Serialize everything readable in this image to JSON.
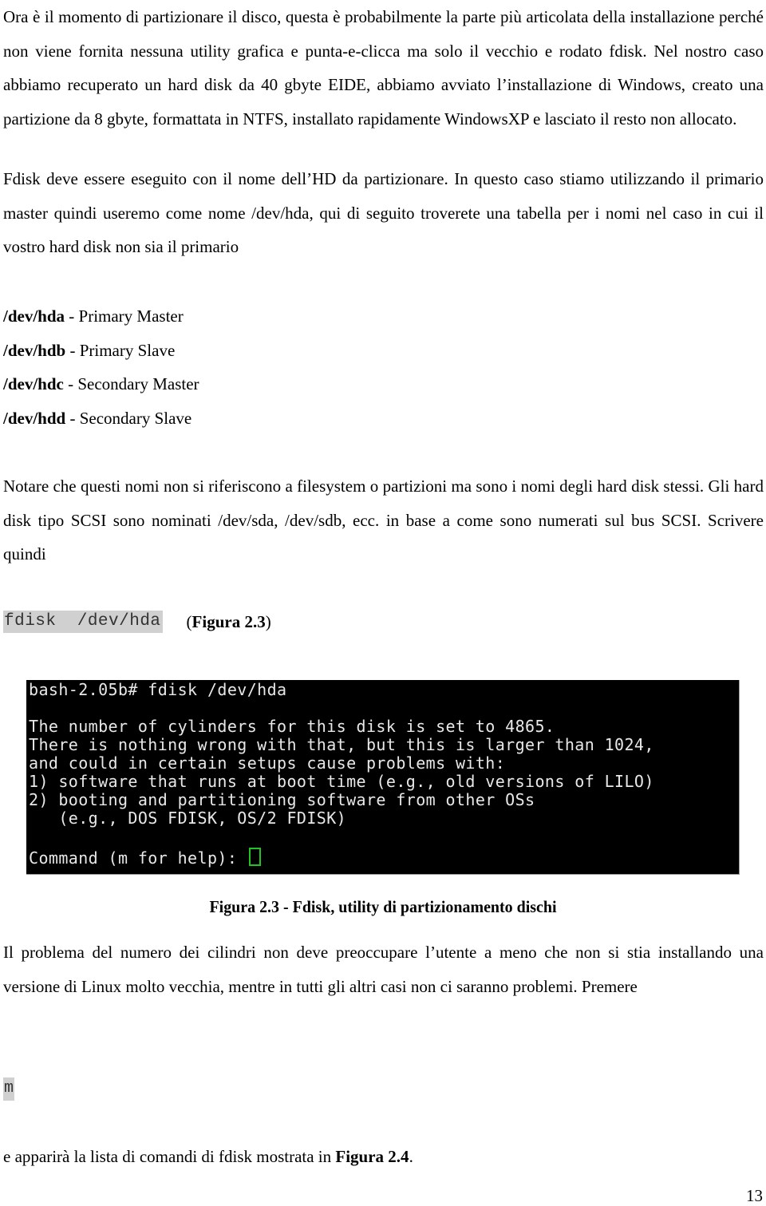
{
  "intro_paragraph": "Ora è il momento di partizionare il disco, questa è probabilmente la parte più articolata della installazione perché non viene fornita nessuna utility grafica e punta-e-clicca ma solo il vecchio e rodato fdisk. Nel nostro caso abbiamo recuperato un hard disk da 40 gbyte EIDE, abbiamo avviato l’installazione di Windows, creato una partizione da 8 gbyte, formattata in NTFS, installato rapidamente WindowsXP e lasciato il resto non allocato.",
  "fdisk_paragraph": "Fdisk deve essere eseguito con il nome dell’HD da partizionare. In questo caso stiamo utilizzando il primario master quindi useremo come nome /dev/hda, qui di seguito troverete una tabella per i nomi nel caso in cui il vostro hard disk non sia il primario",
  "device_list": [
    {
      "device": "/dev/hda",
      "desc": " - Primary Master"
    },
    {
      "device": "/dev/hdb",
      "desc": " - Primary Slave"
    },
    {
      "device": "/dev/hdc",
      "desc": " - Secondary Master"
    },
    {
      "device": "/dev/hdd",
      "desc": " - Secondary Slave"
    }
  ],
  "note_paragraph": "Notare che questi nomi non si riferiscono a filesystem o partizioni ma sono i nomi degli hard disk stessi. Gli hard disk tipo SCSI sono nominati /dev/sda, /dev/sdb, ecc. in base a come sono numerati sul bus SCSI. Scrivere quindi",
  "command": {
    "code": "fdisk  /dev/hda",
    "ref_open": "(",
    "ref_bold": "Figura 2.3",
    "ref_close": ")"
  },
  "terminal": {
    "lines": [
      "bash-2.05b# fdisk /dev/hda",
      "",
      "The number of cylinders for this disk is set to 4865.",
      "There is nothing wrong with that, but this is larger than 1024,",
      "and could in certain setups cause problems with:",
      "1) software that runs at boot time (e.g., old versions of LILO)",
      "2) booting and partitioning software from other OSs",
      "   (e.g., DOS FDISK, OS/2 FDISK)",
      "",
      "Command (m for help): "
    ],
    "cursor_color": "#22c322"
  },
  "figure_caption": "Figura 2.3 - Fdisk, utility di partizionamento dischi",
  "problem_paragraph": "Il problema del numero dei cilindri non deve preoccupare l’utente a meno che non si stia installando una versione di Linux molto vecchia, mentre in tutti gli altri casi non ci saranno problemi. Premere",
  "key": "m",
  "final_line": {
    "text": "e apparirà la lista di comandi di fdisk mostrata in ",
    "bold": "Figura 2.4",
    "tail": "."
  },
  "page_number": "13"
}
